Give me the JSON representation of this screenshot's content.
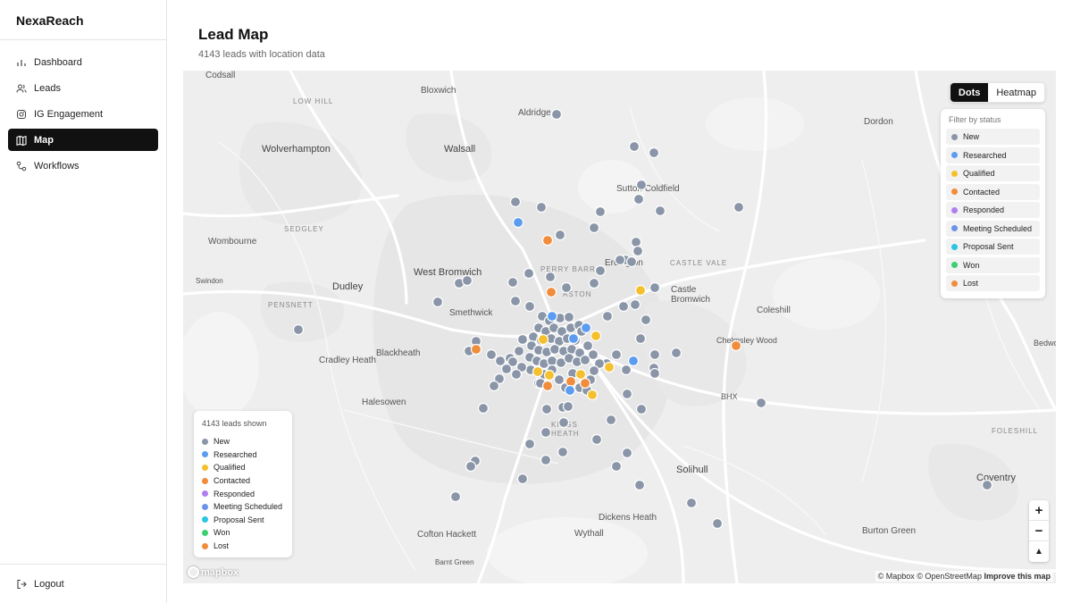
{
  "app": {
    "name": "NexaReach"
  },
  "sidebar": {
    "items": [
      {
        "label": "Dashboard",
        "icon": "bar-chart-icon",
        "active": false
      },
      {
        "label": "Leads",
        "icon": "users-icon",
        "active": false
      },
      {
        "label": "IG Engagement",
        "icon": "instagram-icon",
        "active": false
      },
      {
        "label": "Map",
        "icon": "map-icon",
        "active": true
      },
      {
        "label": "Workflows",
        "icon": "workflow-icon",
        "active": false
      }
    ],
    "logout_label": "Logout"
  },
  "page": {
    "title": "Lead Map",
    "subtitle": "4143 leads with location data"
  },
  "map": {
    "view_toggle": {
      "options": [
        "Dots",
        "Heatmap"
      ],
      "selected": "Dots"
    },
    "filter": {
      "title": "Filter by status",
      "statuses": [
        {
          "label": "New",
          "color": "#8a96a8"
        },
        {
          "label": "Researched",
          "color": "#5b9cf0"
        },
        {
          "label": "Qualified",
          "color": "#f5c02e"
        },
        {
          "label": "Contacted",
          "color": "#f08c3a"
        },
        {
          "label": "Responded",
          "color": "#b07ef0"
        },
        {
          "label": "Meeting Scheduled",
          "color": "#6b94e8"
        },
        {
          "label": "Proposal Sent",
          "color": "#2bc4e4"
        },
        {
          "label": "Won",
          "color": "#3ccf72"
        },
        {
          "label": "Lost",
          "color": "#f08c3a"
        }
      ]
    },
    "legend": {
      "count_label": "4143 leads shown"
    },
    "places": {
      "codsall": "Codsall",
      "low_hill": "LOW HILL",
      "bloxwich": "Bloxwich",
      "aldridge": "Aldridge",
      "dordon": "Dordon",
      "wolverhampton": "Wolverhampton",
      "walsall": "Walsall",
      "sutton_coldfield": "Sutton Coldfield",
      "sedgley": "SEDGLEY",
      "wombourne": "Wombourne",
      "west_bromwich": "West Bromwich",
      "perry_barr": "PERRY BARR",
      "erdington": "Erdington",
      "castle_vale": "CASTLE VALE",
      "dudley": "Dudley",
      "swindon": "Swindon",
      "aston": "ASTON",
      "castle_bromwich": "Castle Bromwich",
      "pensnett": "PENSNETT",
      "smethwick": "Smethwick",
      "coleshill": "Coleshill",
      "chelmsley_wood": "Chelmsley Wood",
      "cradley_heath": "Cradley Heath",
      "blackheath": "Blackheath",
      "bhx": "BHX",
      "halesowen": "Halesowen",
      "kings_heath": "KINGS HEATH",
      "foleshill": "FOLESHILL",
      "solihull": "Solihull",
      "coventry": "Coventry",
      "dickens_heath": "Dickens Heath",
      "cotton_hackett": "Cofton Hackett",
      "wythall": "Wythall",
      "burton_green": "Burton Green",
      "barnt_green": "Barnt Green",
      "bedworth": "Bedworth"
    },
    "zoom": {
      "in": "+",
      "out": "−",
      "compass": "▲"
    },
    "attribution": {
      "text": "© Mapbox © OpenStreetMap",
      "link": "Improve this map"
    },
    "logo": "mapbox"
  }
}
